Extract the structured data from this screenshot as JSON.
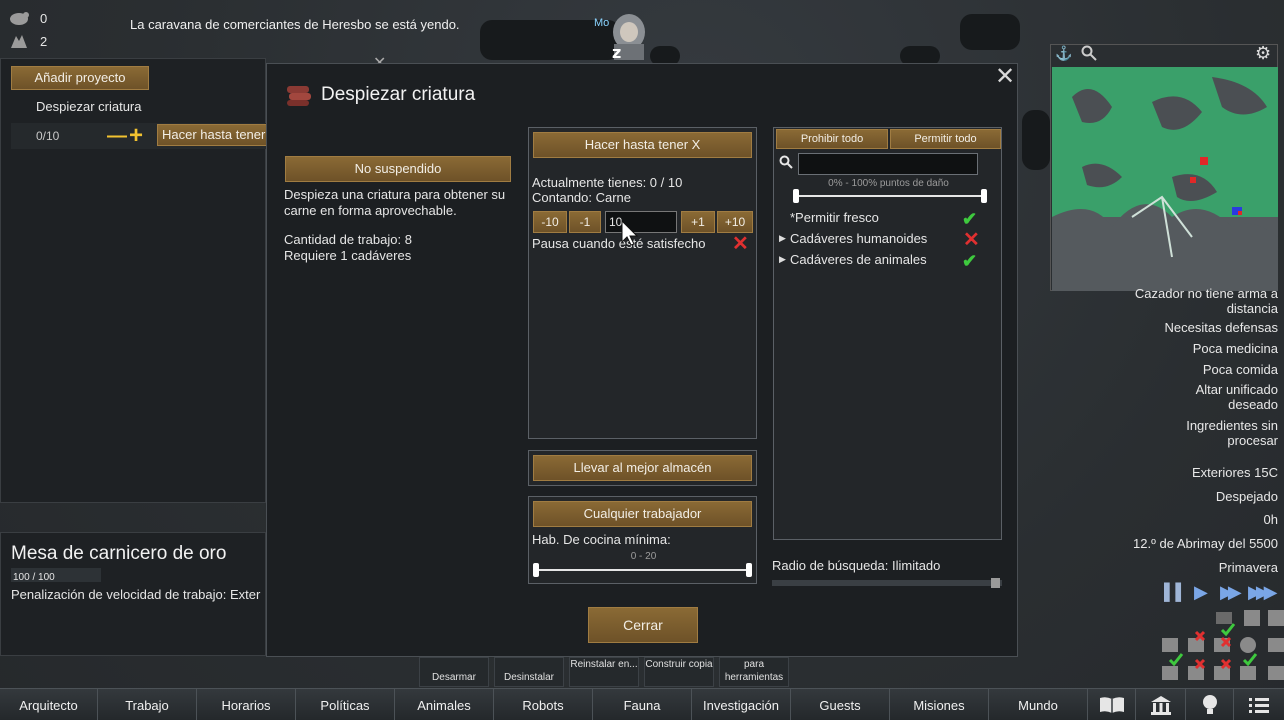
{
  "hud": {
    "counter_1": "0",
    "counter_2": "2",
    "letter": "La caravana de comerciantes de Heresbo se está yendo.",
    "pawn_label": "Mo"
  },
  "bill_panel": {
    "add_bill": "Añadir proyecto",
    "bill_name": "Despiezar criatura",
    "bill_count": "0/10",
    "bill_mode": "Hacer hasta tener"
  },
  "inspect": {
    "title": "Mesa de carnicero de oro",
    "hp": "100 / 100",
    "detail": "Penalización de velocidad de trabajo: Exter"
  },
  "dialog": {
    "title": "Despiezar criatura",
    "suspend": "No suspendido",
    "description": "Despieza una criatura para obtener su carne en forma aprovechable.",
    "work_amount": "Cantidad de trabajo: 8",
    "requires": "Requiere 1 cadáveres",
    "repeat_mode": "Hacer hasta tener X",
    "currently_have": "Actualmente tienes: 0 / 10",
    "counting": "Contando: Carne",
    "steps": [
      "-10",
      "-1",
      "+1",
      "+10"
    ],
    "target_value": "10",
    "pause": "Pausa cuando esté satisfecho",
    "store_mode": "Llevar al mejor almacén",
    "worker": "Cualquier trabajador",
    "skill_label": "Hab. De cocina mínima:",
    "skill_range": "0 - 20",
    "close": "Cerrar",
    "forbid_all": "Prohibir todo",
    "allow_all": "Permitir todo",
    "hp_range": "0% - 100% puntos de daño",
    "filter": [
      {
        "label": "*Permitir fresco",
        "state": "allowed"
      },
      {
        "label": "Cadáveres humanoides",
        "state": "forbidden"
      },
      {
        "label": "Cadáveres de animales",
        "state": "allowed"
      }
    ],
    "radius": "Radio de búsqueda: Ilimitado"
  },
  "alerts": {
    "a1": "Cazador no tiene arma a distancia",
    "a2": "Necesitas defensas",
    "a3": "Poca medicina",
    "a4": "Poca comida",
    "a5": "Altar unificado deseado",
    "a6": "Ingredientes sin procesar"
  },
  "status": {
    "temperature": "Exteriores 15C",
    "weather": "Despejado",
    "hour": "0h",
    "date": "12.º de Abrimay del 5500",
    "season": "Primavera"
  },
  "gizmos": {
    "g1": "Desarmar",
    "g2": "Desinstalar",
    "g3": "Reinstalar en...",
    "g4": "Construir copia",
    "g5": "para herramientas"
  },
  "tabs": [
    "Arquitecto",
    "Trabajo",
    "Horarios",
    "Políticas",
    "Animales",
    "Robots",
    "Fauna",
    "Investigación",
    "Guests",
    "Misiones",
    "Mundo"
  ],
  "colors": {
    "allowed": "#3ec93e",
    "forbidden": "#e03030",
    "button": "#7a5d2e"
  }
}
